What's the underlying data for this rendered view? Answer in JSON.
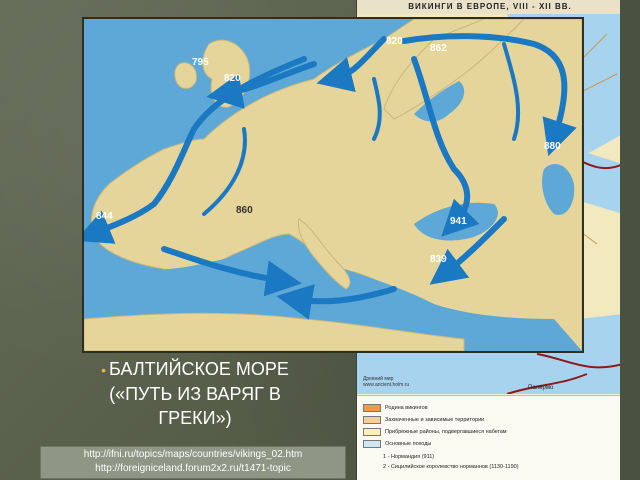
{
  "atlas": {
    "title": "ВИКИНГИ В ЕВРОПЕ, VIII - XII ВВ.",
    "source_line1": "Древний мир",
    "source_line2": "www.ancient.holm.ru",
    "side_label": "Палермо",
    "legend": [
      {
        "color": "#f29a4a",
        "label": "Родина викингов"
      },
      {
        "color": "#f6cf9a",
        "label": "Захваченные и зависимые территории"
      },
      {
        "color": "#fbf0b8",
        "label": "Прибрежные районы, подвергавшиеся набегам"
      },
      {
        "color": "#cfe6f5",
        "label": "Основные походы"
      }
    ],
    "notes": [
      "1 - Нормандия (911)",
      "2 - Сицилийское королевство норманнов (1130-1190)"
    ]
  },
  "map": {
    "dates": [
      "795",
      "820",
      "820",
      "862",
      "880",
      "844",
      "860",
      "941",
      "839"
    ]
  },
  "slide": {
    "bullet_lines": [
      "БАЛТИЙСКОЕ МОРЕ",
      "(«ПУТЬ ИЗ ВАРЯГ В",
      "ГРЕКИ»)"
    ]
  },
  "sources": {
    "line1": "http://ifni.ru/topics/maps/countries/vikings_02.htm",
    "line2": "http://foreigniceland.forum2x2.ru/t1471-topic"
  }
}
